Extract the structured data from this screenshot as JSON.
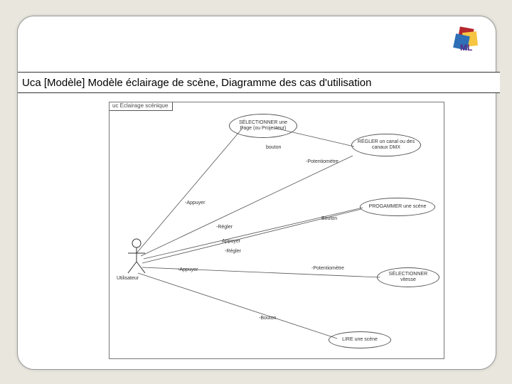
{
  "title": "Uca [Modèle] Modèle éclairage de scène, Diagramme des cas d'utilisation",
  "frame_label": "uc Eclairage scénique",
  "actor_name": "Utilisateur",
  "usecases": {
    "uc1": "SÉLECTIONNER une Page (ou Projecteur)",
    "uc2": "RÉGLER un canal ou des canaux DMX",
    "uc3": "PROGAMMER une scène",
    "uc4": "SÉLECTIONNER vitesse",
    "uc5": "LIRE une scène"
  },
  "labels": {
    "bouton1": "bouton",
    "pot1": "-Potentiomètre",
    "appuyer1": "-Appuyer",
    "regler1": "-Régler",
    "appuyer2": "Appuyer",
    "regler2": "-Régler",
    "appuyer3": "-Appuyer",
    "bouton2": "Bouton",
    "pot2": "-Potentiomètre",
    "bouton3": "-Bouton"
  },
  "logo_alt": "SysML"
}
